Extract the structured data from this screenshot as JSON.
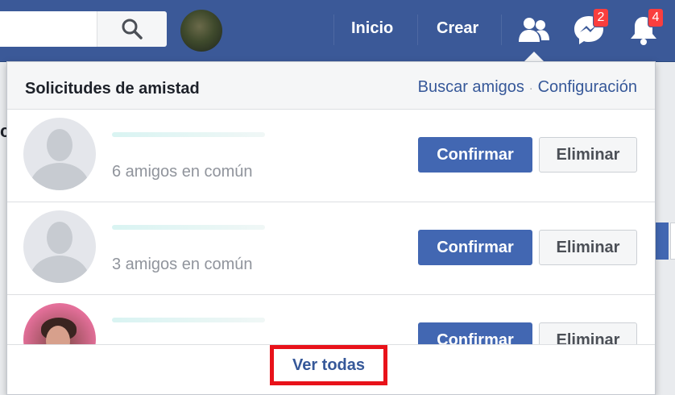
{
  "topbar": {
    "search": {
      "value": "",
      "placeholder": ""
    },
    "nav": {
      "home_label": "Inicio",
      "create_label": "Crear"
    },
    "badges": {
      "messages_count": "2",
      "notifications_count": "4"
    },
    "icons": {
      "search": "search-icon",
      "friends": "friends-icon",
      "messenger": "messenger-icon",
      "notifications": "bell-icon"
    },
    "colors": {
      "bar": "#3b5998",
      "badge": "#fa3e3e"
    }
  },
  "friend_requests": {
    "title": "Solicitudes de amistad",
    "find_friends_label": "Buscar amigos",
    "separator": "·",
    "settings_label": "Configuración",
    "items": [
      {
        "mutual": "6 amigos en común",
        "confirm_label": "Confirmar",
        "delete_label": "Eliminar",
        "avatar": "placeholder"
      },
      {
        "mutual": "3 amigos en común",
        "confirm_label": "Confirmar",
        "delete_label": "Eliminar",
        "avatar": "placeholder"
      },
      {
        "mutual": "",
        "confirm_label": "Confirmar",
        "delete_label": "Eliminar",
        "avatar": "photo"
      }
    ],
    "see_all_label": "Ver todas",
    "highlight_color": "#e8121a"
  }
}
